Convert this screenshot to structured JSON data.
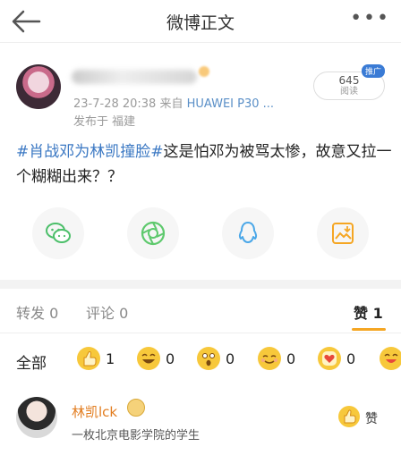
{
  "header": {
    "title": "微博正文",
    "back_icon": "back-arrow-icon",
    "more_icon": "more-icon"
  },
  "author": {
    "meta_date": "23-7-28 20:38",
    "meta_from": "来自",
    "meta_device": "HUAWEI P30 ...",
    "location": "发布于 福建",
    "read_count": "645",
    "read_label": "阅读",
    "promo_label": "推广"
  },
  "post": {
    "topic": "#肖战邓为林凯撞脸#",
    "text": "这是怕邓为被骂太惨，故意又拉一个糊糊出来？？"
  },
  "share": {
    "items": [
      "wechat-icon",
      "moments-icon",
      "qq-icon",
      "save-image-icon"
    ],
    "colors": {
      "wechat": "#4cbf6a",
      "moments": "#5ec96d",
      "qq": "#4aa7e8",
      "save": "#f5a623"
    }
  },
  "tabs": {
    "repost": "转发 0",
    "comment": "评论 0",
    "like": "赞 1"
  },
  "reactions": {
    "all_label": "全部",
    "items": [
      {
        "icon": "thumbs-up-emoji-icon",
        "count": "1"
      },
      {
        "icon": "laugh-emoji-icon",
        "count": "0"
      },
      {
        "icon": "surprised-emoji-icon",
        "count": "0"
      },
      {
        "icon": "smile-emoji-icon",
        "count": "0"
      },
      {
        "icon": "heart-emoji-icon",
        "count": "0"
      }
    ]
  },
  "comment": {
    "name": "林凯lck",
    "bio": "一枚北京电影学院的学生",
    "like_label": "赞"
  }
}
